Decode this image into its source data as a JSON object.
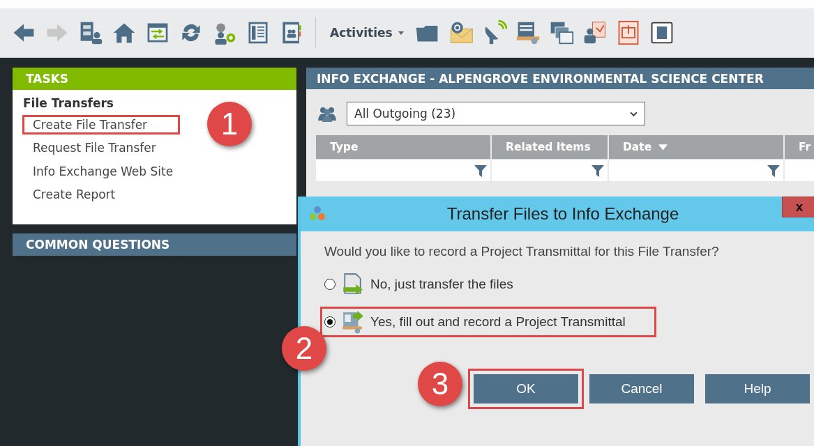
{
  "toolbar": {
    "menu_label": "Activities"
  },
  "tasks": {
    "title": "TASKS",
    "section": "File Transfers",
    "items": [
      {
        "label": "Create File Transfer",
        "highlighted": true,
        "callout": "1"
      },
      {
        "label": "Request File Transfer",
        "highlighted": false
      },
      {
        "label": "Info Exchange Web Site",
        "highlighted": false
      },
      {
        "label": "Create Report",
        "highlighted": false
      }
    ]
  },
  "common_questions": {
    "title": "COMMON QUESTIONS"
  },
  "info_exchange": {
    "title": "INFO EXCHANGE - ALPENGROVE ENVIRONMENTAL SCIENCE CENTER",
    "filter": {
      "value": "All Outgoing (23)"
    },
    "table": {
      "columns": [
        {
          "label": "Type",
          "sorted": false
        },
        {
          "label": "Related Items",
          "sorted": false
        },
        {
          "label": "Date",
          "sorted": true
        },
        {
          "label": "Fr"
        }
      ]
    }
  },
  "dialog": {
    "title": "Transfer Files to Info Exchange",
    "question": "Would you like to record a Project Transmittal for this File Transfer?",
    "options": [
      {
        "label": "No, just transfer the files",
        "kind": "plain",
        "selected": false,
        "highlighted": false
      },
      {
        "label": "Yes, fill out and record a Project Transmittal",
        "kind": "transmittal",
        "selected": true,
        "highlighted": true,
        "callout": "2"
      }
    ],
    "buttons": [
      {
        "label": "OK",
        "highlighted": true,
        "callout": "3"
      },
      {
        "label": "Cancel",
        "highlighted": false
      },
      {
        "label": "Help",
        "highlighted": false
      }
    ],
    "close_label": "x"
  }
}
